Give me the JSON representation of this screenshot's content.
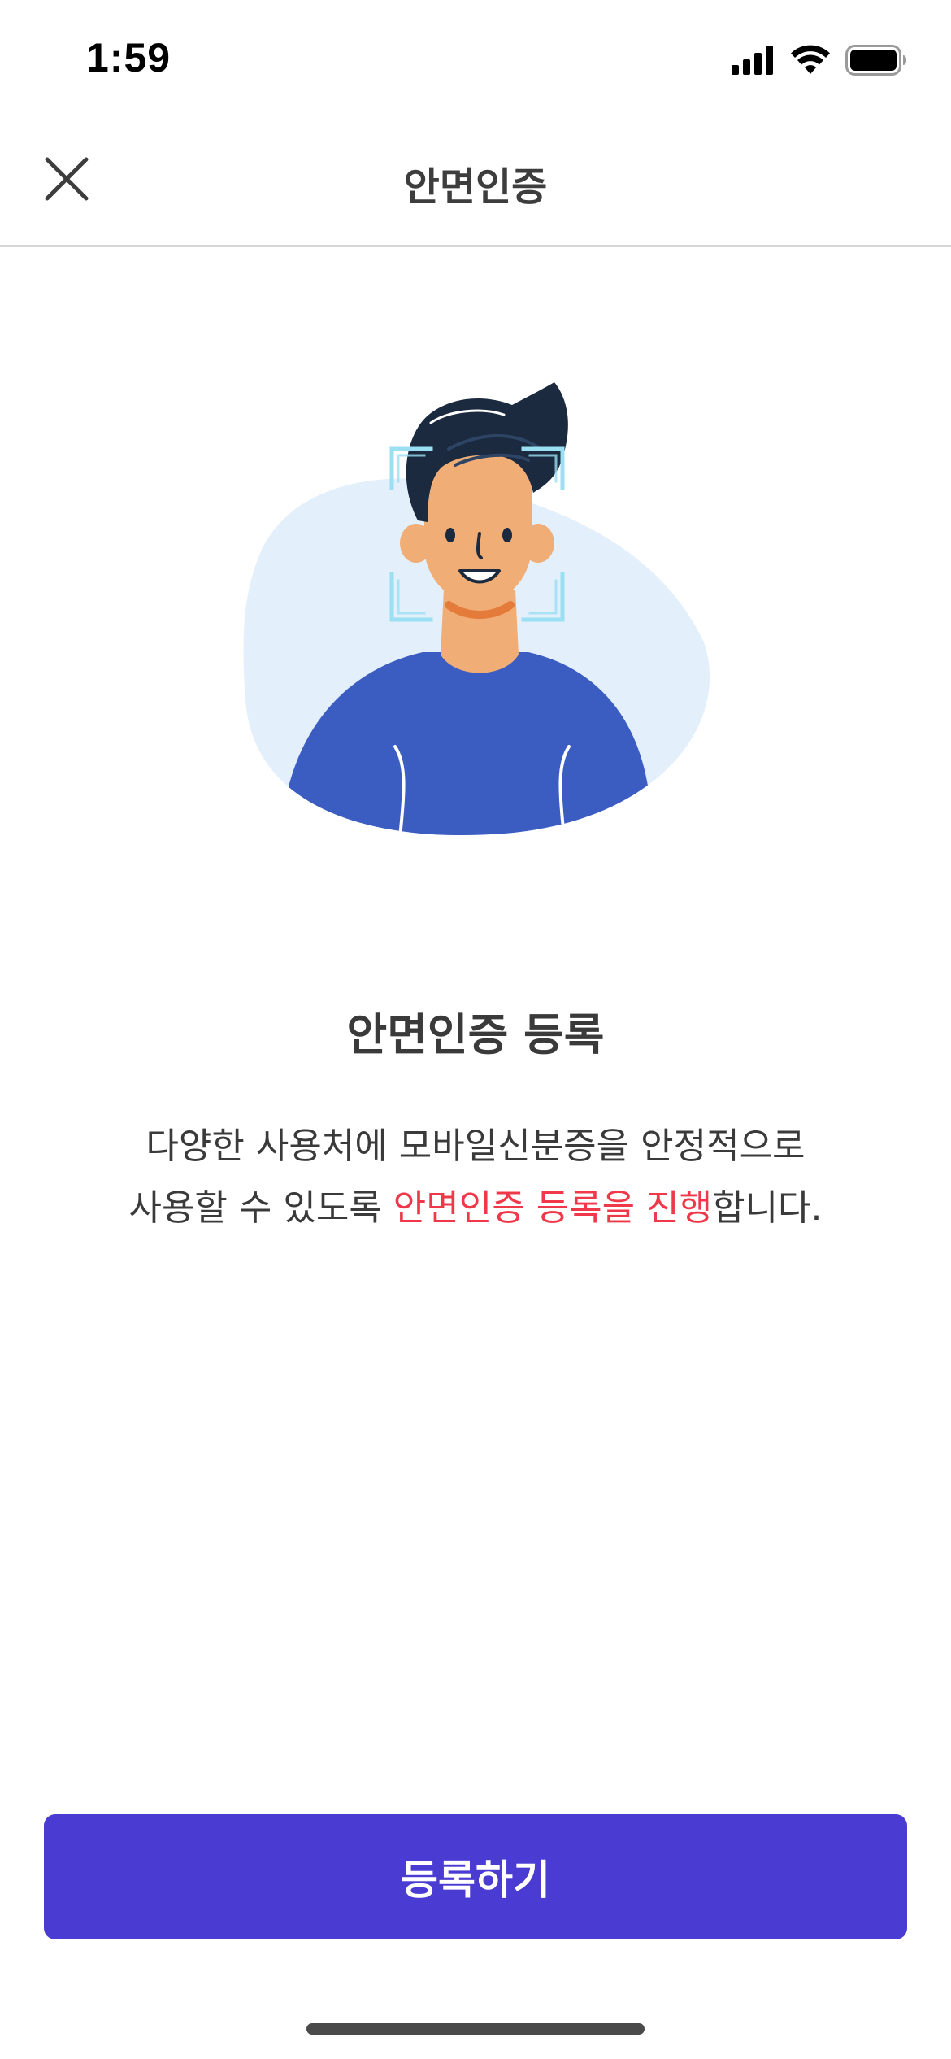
{
  "status_bar": {
    "time": "1:59"
  },
  "nav": {
    "title": "안면인증",
    "close_icon": "close-icon"
  },
  "main": {
    "heading": "안면인증 등록",
    "description_line1": "다양한 사용처에 모바일신분증을 안정적으로",
    "description_line2_prefix": "사용할 수 있도록 ",
    "description_line2_highlight": "안면인증 등록을 진행",
    "description_line2_suffix": "합니다."
  },
  "actions": {
    "register_label": "등록하기"
  },
  "colors": {
    "primary": "#4a3bd3",
    "highlight": "#f0384b",
    "text": "#3a3a3a",
    "illustration_bg": "#e3effb",
    "shirt": "#3b5cc0",
    "skin": "#f0ad75",
    "hair": "#1b2a3e",
    "scan_frame": "#9adff2"
  }
}
